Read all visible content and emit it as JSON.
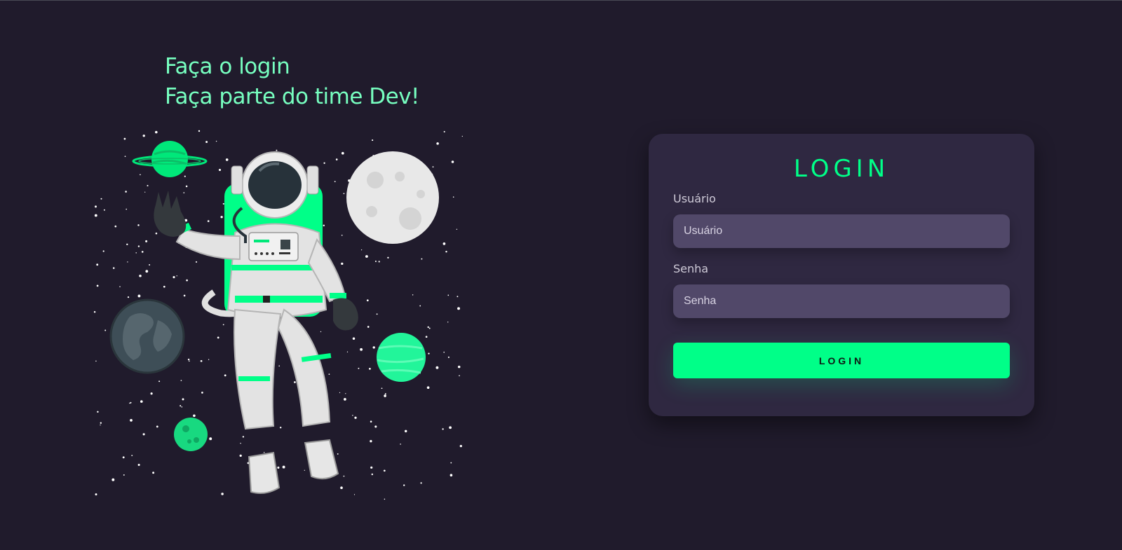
{
  "headline": {
    "line1": "Faça o login",
    "line2": "Faça parte do time Dev!"
  },
  "illustration": {
    "icon": "astronaut-space-illustration"
  },
  "login_card": {
    "title": "LOGIN",
    "username": {
      "label": "Usuário",
      "placeholder": "Usuário",
      "value": ""
    },
    "password": {
      "label": "Senha",
      "placeholder": "Senha",
      "value": ""
    },
    "button_label": "LOGIN"
  },
  "colors": {
    "background": "#201b2c",
    "card": "#2f2841",
    "input": "#514869",
    "accent": "#00ff88",
    "headline": "#77ffc0"
  }
}
